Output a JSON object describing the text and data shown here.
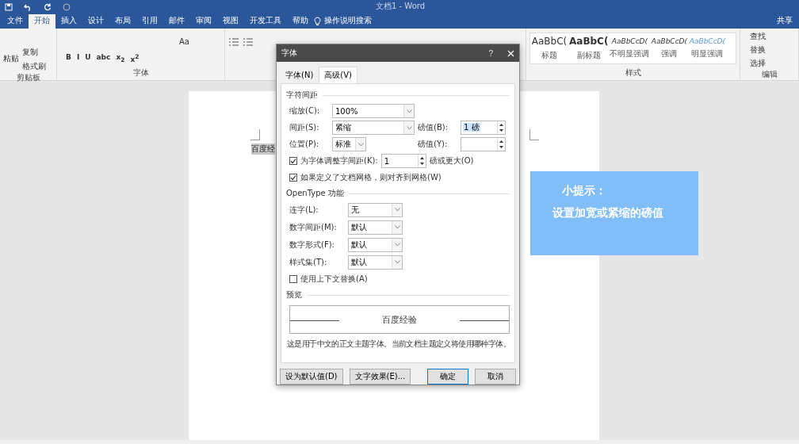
{
  "window": {
    "title": "文档1 - Word"
  },
  "menu_tabs": [
    {
      "label": "文件",
      "selected": false
    },
    {
      "label": "开始",
      "selected": true
    },
    {
      "label": "插入",
      "selected": false
    },
    {
      "label": "设计",
      "selected": false
    },
    {
      "label": "布局",
      "selected": false
    },
    {
      "label": "引用",
      "selected": false
    },
    {
      "label": "邮件",
      "selected": false
    },
    {
      "label": "审阅",
      "selected": false
    },
    {
      "label": "视图",
      "selected": false
    },
    {
      "label": "开发工具",
      "selected": false
    },
    {
      "label": "帮助",
      "selected": false
    }
  ],
  "tell_me": "操作说明搜索",
  "share": "共享",
  "clipboard": {
    "paste": "粘贴",
    "copy": "复制",
    "format_painter": "格式刷",
    "label": "剪贴板"
  },
  "font_group": {
    "label": "字体",
    "case_button": "Aa",
    "format_buttons": [
      "B",
      "I",
      "U",
      "abc",
      "x$_{2}$",
      "x$^{2}$"
    ]
  },
  "styles": {
    "label": "样式",
    "items": [
      {
        "sample": "AaBbC(",
        "name": "标题",
        "kind": "heading"
      },
      {
        "sample": "AaBbC(",
        "name": "副标题",
        "kind": "bold"
      },
      {
        "sample": "AaBbCcD(",
        "name": "不明显强调",
        "kind": "subtle"
      },
      {
        "sample": "AaBbCcD(",
        "name": "强调",
        "kind": "emphasis"
      },
      {
        "sample": "AaBbCcD(",
        "name": "明显强调",
        "kind": "intense"
      }
    ]
  },
  "editing": {
    "label": "编辑",
    "find": "查找",
    "replace": "替换",
    "select": "选择"
  },
  "document": {
    "text": "百度经"
  },
  "dialog": {
    "title": "字体",
    "help": "?",
    "tabs": [
      {
        "label": "字体(N)",
        "selected": false
      },
      {
        "label": "高级(V)",
        "selected": true
      }
    ],
    "spacing_section": "字符间距",
    "scale": {
      "label": "缩放(C):",
      "value": "100%"
    },
    "spacing": {
      "label": "间距(S):",
      "value": "紧缩"
    },
    "spacing_by": {
      "label": "磅值(B):",
      "value": "1 磅",
      "selected": true
    },
    "position": {
      "label": "位置(P):",
      "value": "标准"
    },
    "position_by": {
      "label": "磅值(Y):"
    },
    "kerning": {
      "label": "为字体调整字间距(K):",
      "checked": true,
      "value": "1",
      "suffix": "磅或更大(O)"
    },
    "snap_grid": {
      "label": "如果定义了文档网格，则对齐到网格(W)",
      "checked": true
    },
    "opentype_section": "OpenType 功能",
    "opentype_fields": [
      {
        "label": "连字(L):",
        "value": "无"
      },
      {
        "label": "数字间距(M):",
        "value": "默认"
      },
      {
        "label": "数字形式(F):",
        "value": "默认"
      },
      {
        "label": "样式集(T):",
        "value": "默认"
      }
    ],
    "contextual": {
      "label": "使用上下文替换(A)",
      "checked": false
    },
    "preview_section": "预览",
    "preview_text": "百度经验",
    "description": "这是用于中文的正文主题字体。当前文档主题定义将使用哪种字体。",
    "buttons": [
      {
        "label": "设为默认值(D)",
        "default": false
      },
      {
        "label": "文字效果(E)...",
        "default": false
      },
      {
        "label": "确定",
        "default": true
      },
      {
        "label": "取消",
        "default": false
      }
    ]
  },
  "tip": {
    "title": "小提示：",
    "text": "设置加宽或紧缩的磅值"
  }
}
